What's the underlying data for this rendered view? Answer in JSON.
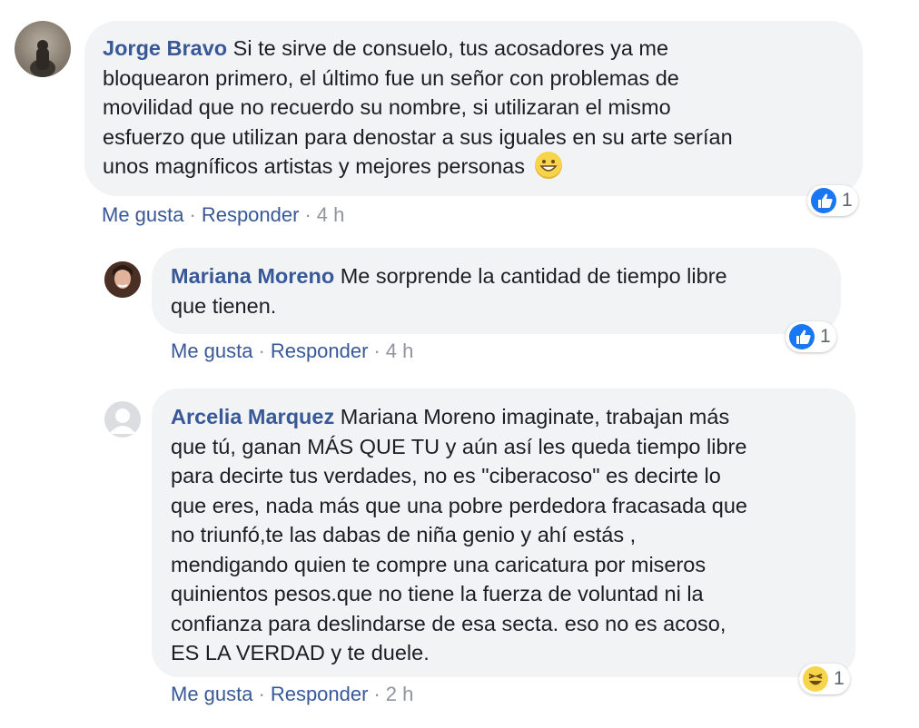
{
  "comments": [
    {
      "author": "Jorge Bravo",
      "lines": [
        "Si te sirve de consuelo, tus acosadores ya me",
        "bloquearon primero, el último fue un señor con problemas de",
        "movilidad que no recuerdo su nombre, si utilizaran el mismo",
        "esfuerzo que utilizan para denostar a sus iguales en su arte serían",
        "unos magníficos artistas y mejores personas"
      ],
      "like_label": "Me gusta",
      "reply_label": "Responder",
      "time": "4 h",
      "reaction_type": "like",
      "reaction_count": "1",
      "trailing_emoji": "grinning-face"
    },
    {
      "author": "Mariana Moreno",
      "lines": [
        "Me sorprende la cantidad de tiempo libre",
        "que tienen."
      ],
      "like_label": "Me gusta",
      "reply_label": "Responder",
      "time": "4 h",
      "reaction_type": "like",
      "reaction_count": "1"
    },
    {
      "author": "Arcelia Marquez",
      "lines": [
        "Mariana Moreno imaginate, trabajan más",
        "que tú, ganan MÁS QUE TU y aún así les queda tiempo libre",
        "para decirte tus verdades, no es \"ciberacoso\" es decirte lo",
        "que eres, nada más que una pobre perdedora fracasada que",
        "no triunfó,te las dabas de niña genio y ahí estás ,",
        "mendigando quien te compre una caricatura por miseros",
        "quinientos pesos.que no tiene la fuerza de voluntad ni la",
        "confianza para deslindarse de esa secta. eso no es acoso,",
        "ES LA VERDAD y te duele."
      ],
      "like_label": "Me gusta",
      "reply_label": "Responder",
      "time": "2 h",
      "reaction_type": "haha",
      "reaction_count": "1"
    }
  ],
  "colors": {
    "author": "#385898",
    "bubble": "#f2f3f5",
    "meta": "#90949c",
    "like_blue": "#1877f2",
    "haha_yellow": "#f7d44b"
  }
}
